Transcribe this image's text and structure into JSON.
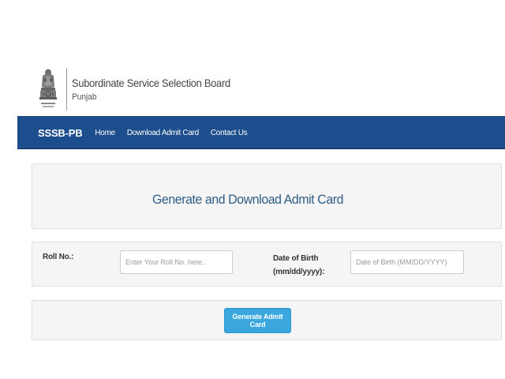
{
  "header": {
    "emblem_icon": "ashoka-emblem-icon",
    "org_name": "Subordinate Service Selection Board",
    "org_state": "Punjab"
  },
  "navbar": {
    "brand": "SSSB-PB",
    "links": [
      {
        "label": "Home"
      },
      {
        "label": "Download Admit Card"
      },
      {
        "label": "Contact Us"
      }
    ],
    "background": "#1c4d8c"
  },
  "main": {
    "title": "Generate and Download Admit Card",
    "form": {
      "roll_label": "Roll No.:",
      "roll_placeholder": "Enter Your Roll No. here..",
      "roll_value": "",
      "dob_label_line1": "Date of Birth",
      "dob_label_line2": "(mm/dd/yyyy):",
      "dob_placeholder": "Date of Birth (MM/DD/YYYY)",
      "dob_value": ""
    },
    "submit_label": "Generate Admit Card",
    "button_color": "#3aa8de"
  }
}
